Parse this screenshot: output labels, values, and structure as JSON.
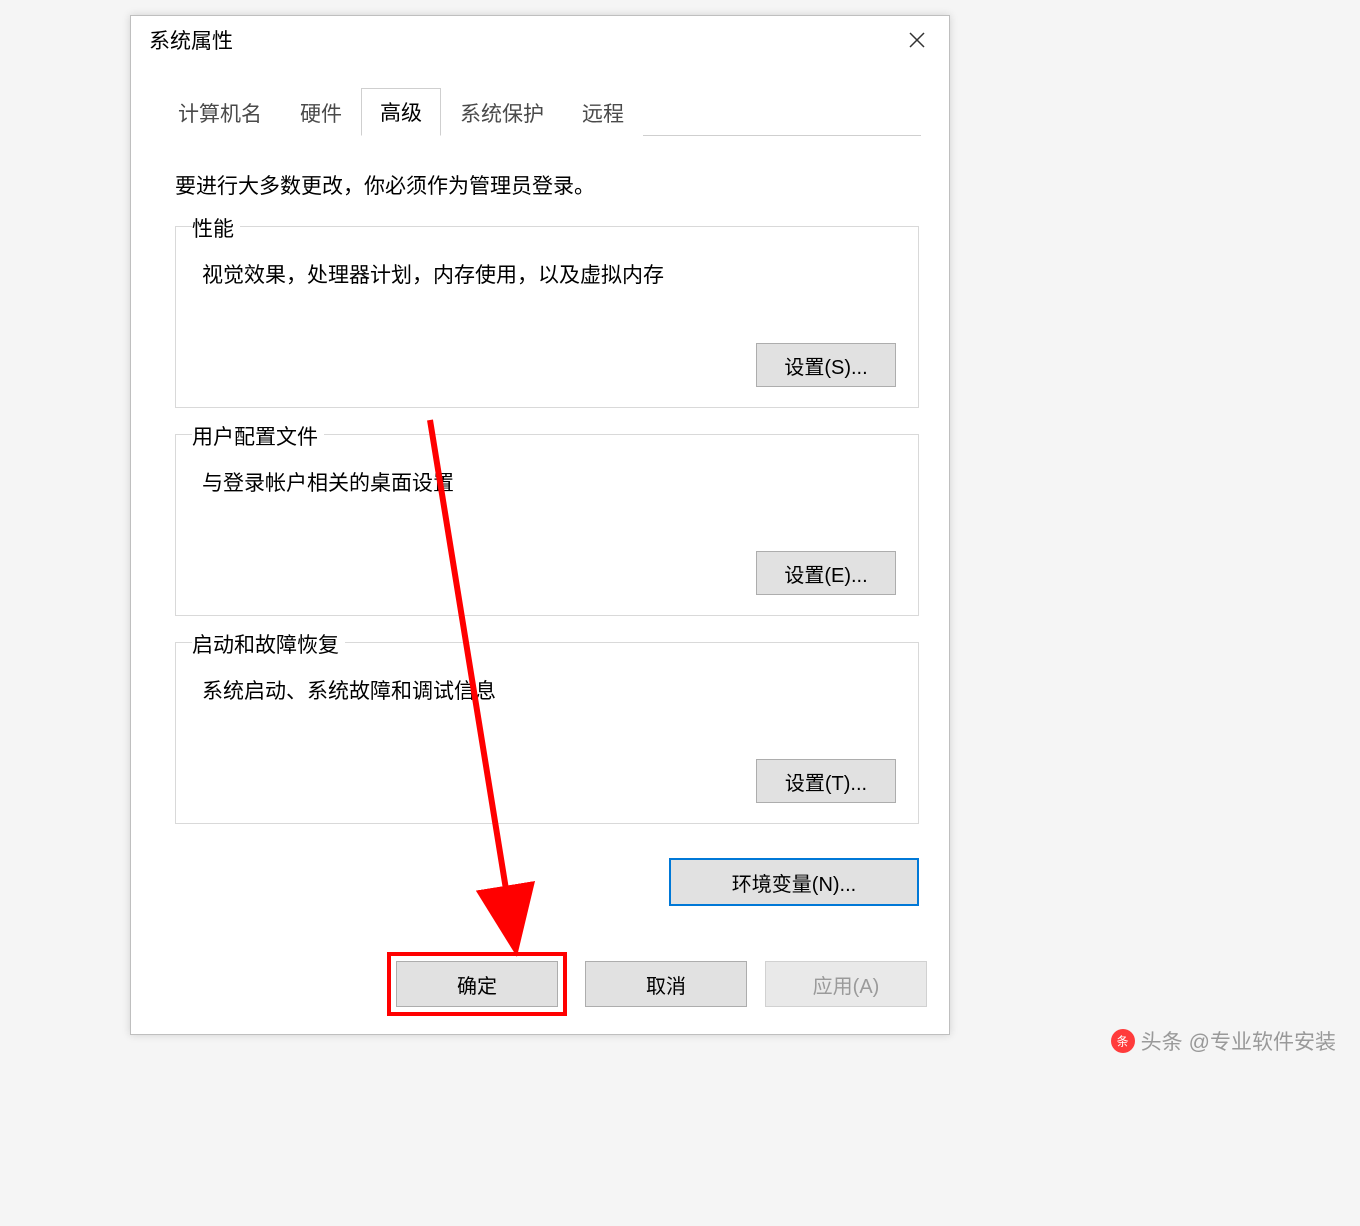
{
  "dialog": {
    "title": "系统属性",
    "tabs": [
      {
        "label": "计算机名"
      },
      {
        "label": "硬件"
      },
      {
        "label": "高级"
      },
      {
        "label": "系统保护"
      },
      {
        "label": "远程"
      }
    ],
    "active_tab_index": 2,
    "intro": "要进行大多数更改，你必须作为管理员登录。",
    "groups": {
      "performance": {
        "title": "性能",
        "desc": "视觉效果，处理器计划，内存使用，以及虚拟内存",
        "button": "设置(S)..."
      },
      "userprofile": {
        "title": "用户配置文件",
        "desc": "与登录帐户相关的桌面设置",
        "button": "设置(E)..."
      },
      "startup": {
        "title": "启动和故障恢复",
        "desc": "系统启动、系统故障和调试信息",
        "button": "设置(T)..."
      }
    },
    "envvars_button": "环境变量(N)...",
    "footer": {
      "ok": "确定",
      "cancel": "取消",
      "apply": "应用(A)"
    }
  },
  "watermark": {
    "prefix": "头条",
    "handle": "@专业软件安装"
  }
}
